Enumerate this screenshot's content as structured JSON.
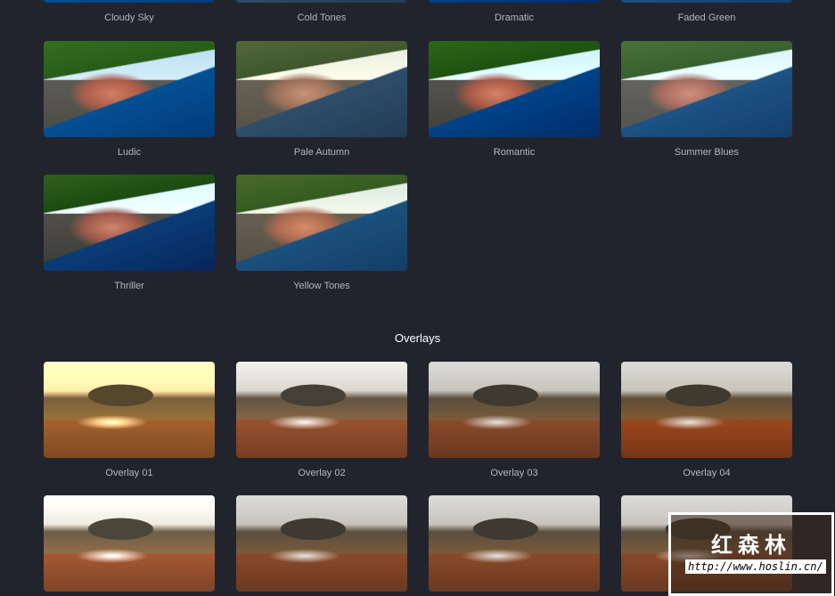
{
  "filters": {
    "row0": [
      "Cloudy Sky",
      "Cold Tones",
      "Dramatic",
      "Faded Green"
    ],
    "row1": [
      "Ludic",
      "Pale Autumn",
      "Romantic",
      "Summer Blues"
    ],
    "row2": [
      "Thriller",
      "Yellow Tones"
    ]
  },
  "overlays_heading": "Overlays",
  "overlays": {
    "row0": [
      "Overlay 01",
      "Overlay 02",
      "Overlay 03",
      "Overlay 04"
    ]
  },
  "watermark": {
    "text": "红森林",
    "url": "http://www.hoslin.cn/"
  }
}
